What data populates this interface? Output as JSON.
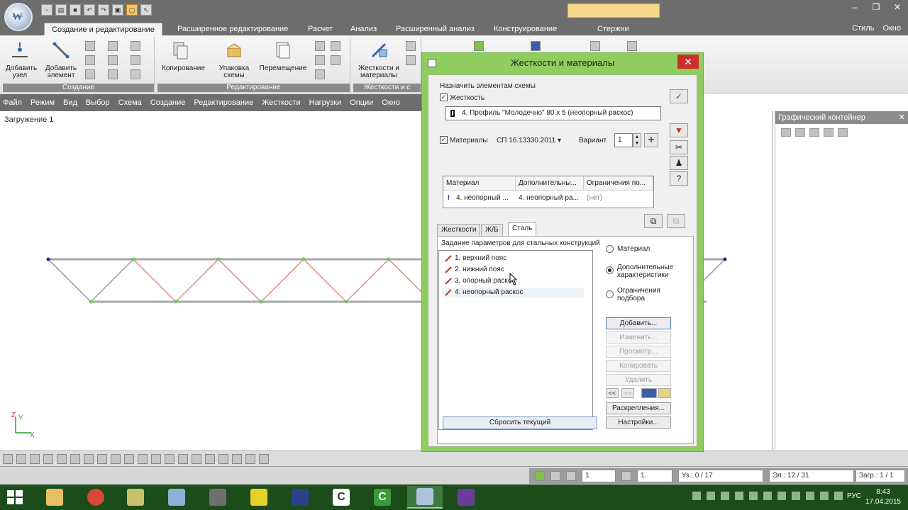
{
  "ribbon": {
    "tabs": [
      "Создание и редактирование",
      "Расширенное редактирование",
      "Расчет",
      "Анализ",
      "Расширенный анализ",
      "Конструирование",
      "Стержни"
    ],
    "active_tab": 0,
    "right_items": [
      "Стиль",
      "Окно"
    ],
    "groups": {
      "create": {
        "label": "Создание",
        "add_node": "Добавить узел",
        "add_element": "Добавить элемент"
      },
      "edit": {
        "label": "Редактирование",
        "copy": "Копирование",
        "pack": "Упаковка схемы",
        "move": "Перемещение"
      },
      "stiff": {
        "label": "Жесткости и с",
        "stiff_materials": "Жесткости и материалы"
      }
    }
  },
  "menu": [
    "Файл",
    "Режим",
    "Вид",
    "Выбор",
    "Схема",
    "Создание",
    "Редактирование",
    "Жесткости",
    "Нагрузки",
    "Опции",
    "Окно"
  ],
  "canvas": {
    "load_label": "Загружение 1",
    "axis_z": "Z",
    "axis_y": "Y",
    "axis_x": "X"
  },
  "graphic_container": {
    "title": "Графический контейнер"
  },
  "dialog": {
    "title": "Жесткости и материалы",
    "assign_label": "Назначить элементам схемы",
    "stiffness_label": "Жесткость",
    "stiffness_value": "4. Профиль \"Молодечно\" 80 x 5 (неопорный раскос)",
    "materials_label": "Материалы",
    "code_value": "СП 16.13330.2011",
    "variant_label": "Вариант",
    "variant_value": "1",
    "table": {
      "headers": [
        "Материал",
        "Дополнительны...",
        "Ограничения по..."
      ],
      "row": [
        "4. неопорный ...",
        "4. неопорный ра...",
        "(нет)"
      ]
    },
    "tabs": [
      "Жесткости",
      "Ж/Б",
      "Сталь"
    ],
    "active_tab": 2,
    "panel_title": "Задание параметров для стальных конструкций",
    "list": [
      "1. верхний пояс",
      "2. нижний пояс",
      "3. опорный раскос",
      "4. неопорный раскос"
    ],
    "radios": [
      "Материал",
      "Дополнительные характеристики",
      "Ограничения подбора"
    ],
    "radio_selected": 1,
    "buttons": {
      "add": "Добавить...",
      "change": "Изменить...",
      "view": "Просмотр...",
      "copy": "Копировать",
      "delete": "Удалить",
      "prev": "<<",
      "next": ">>",
      "bracing": "Раскрепления...",
      "settings": "Настройки...",
      "reset": "Сбросить текущий"
    }
  },
  "status": {
    "field1": "1.",
    "field2": "1.",
    "nodes": "Уз.: 0 / 17",
    "elements": "Эл.: 12 / 31",
    "load": "Загр.: 1 / 1"
  },
  "taskbar": {
    "lang": "РУС",
    "time": "8:43",
    "date": "17.04.2015"
  },
  "colors": {
    "dialog_frame": "#8fce5e",
    "taskbar": "#1b4d1b",
    "chrome": "#6d6d6d",
    "truss_chord": "#a8a8a8",
    "truss_diagonal": "#d98c8c",
    "node": "#66cc55"
  }
}
